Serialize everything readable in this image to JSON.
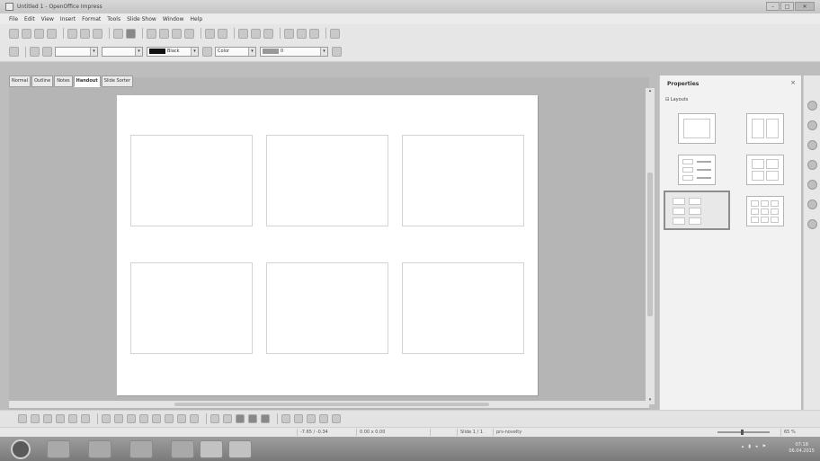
{
  "window": {
    "title": "Untitled 1 - OpenOffice Impress"
  },
  "menu": [
    "File",
    "Edit",
    "View",
    "Insert",
    "Format",
    "Tools",
    "Slide Show",
    "Window",
    "Help"
  ],
  "toolbar2": {
    "line_color_label": "Black",
    "area_style_label": "Color",
    "area_color_label": "0"
  },
  "view_tabs": [
    "Normal",
    "Outline",
    "Notes",
    "Handout",
    "Slide Sorter"
  ],
  "active_view_tab": "Handout",
  "sidebar": {
    "title": "Properties",
    "close_label": "×",
    "section_label": "Layouts"
  },
  "status": {
    "position": "-7.65 / -0.34",
    "size": "0.00 x 0.00",
    "slide": "Slide 1 / 1",
    "layout_name": "prs-novelty",
    "zoom": "65 %"
  },
  "taskbar": {
    "clock_time": "07:18",
    "clock_date": "06.04.2015"
  },
  "icons": [
    "app-icon",
    "minimize-icon",
    "maximize-icon",
    "close-icon",
    "start-icon",
    "properties-icon",
    "slide-transition-icon",
    "master-pages-icon",
    "animation-icon",
    "navigator-icon",
    "gallery-icon"
  ]
}
